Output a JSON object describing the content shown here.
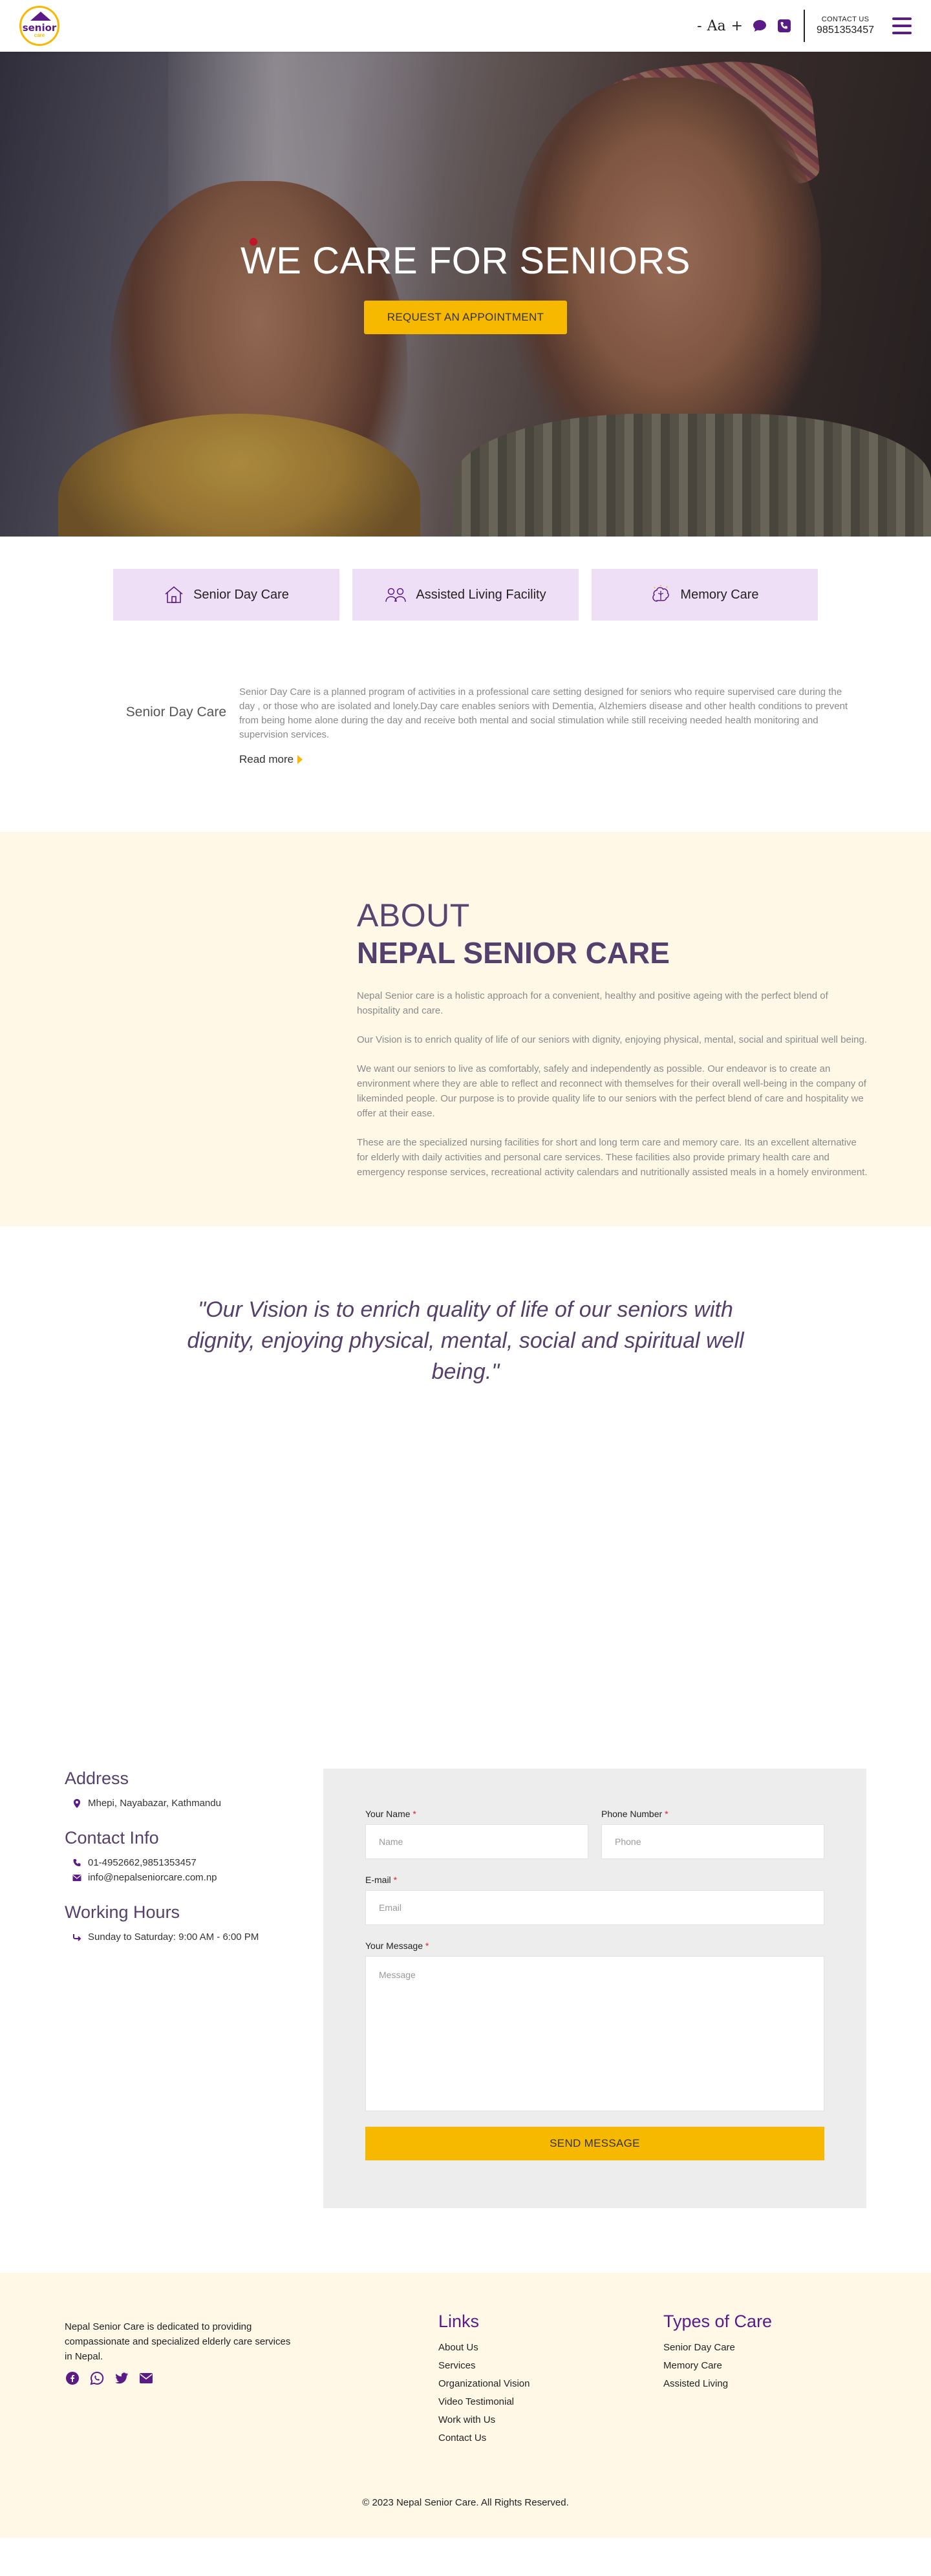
{
  "brand": {
    "logo_text": "senior",
    "logo_subtext": "care",
    "accent_purple": "#5a1b86",
    "accent_yellow": "#f7b800"
  },
  "header": {
    "font_decrease": "-",
    "font_label": "Aa",
    "font_increase": "+",
    "contact_label": "CONTACT US",
    "contact_number": "9851353457"
  },
  "hero": {
    "title": "WE CARE FOR SENIORS",
    "button": "REQUEST AN APPOINTMENT"
  },
  "services": {
    "tabs": [
      {
        "label": "Senior Day Care",
        "icon": "house-icon"
      },
      {
        "label": "Assisted Living Facility",
        "icon": "people-icon"
      },
      {
        "label": "Memory Care",
        "icon": "brain-icon"
      }
    ],
    "detail_title": "Senior Day Care",
    "detail_text": "Senior Day Care is a planned program of activities in a professional care setting designed for seniors who require supervised care during the day , or those who are isolated and lonely.Day care enables seniors with Dementia, Alzhemiers disease and other health conditions to prevent from being home alone during the day and receive both mental and social stimulation while still receiving needed health monitoring and supervision services.",
    "read_more": "Read more"
  },
  "about": {
    "pre_title": "ABOUT",
    "title": "NEPAL SENIOR CARE",
    "paragraphs": [
      "Nepal Senior care is a holistic approach for a convenient, healthy and positive ageing with the perfect blend of hospitality and care.",
      "Our Vision is to enrich quality of life of our seniors with dignity, enjoying physical, mental, social and spiritual well being.",
      "We want our seniors to live as comfortably, safely and independently as possible. Our endeavor is to create an environment where they are able to reflect and reconnect with themselves for their overall well-being in the company of likeminded people. Our purpose is to provide quality life to our seniors with the perfect blend of care and hospitality we offer at their ease.",
      "These are the specialized nursing facilities for short and long term care and memory care. Its an excellent alternative for elderly with daily activities and personal care services. These facilities also provide primary health care and emergency response services, recreational activity calendars and nutritionally assisted meals in a homely environment."
    ]
  },
  "quote": "\"Our Vision is to enrich quality of life of our seniors with dignity, enjoying physical, mental, social and spiritual well being.\"",
  "contact": {
    "address_head": "Address",
    "address": "Mhepi, Nayabazar, Kathmandu",
    "info_head": "Contact Info",
    "phones": "01-4952662,9851353457",
    "email": "info@nepalseniorcare.com.np",
    "hours_head": "Working Hours",
    "hours": "Sunday to Saturday: 9:00 AM - 6:00 PM"
  },
  "form": {
    "name_label": "Your Name",
    "name_placeholder": "Name",
    "phone_label": "Phone Number",
    "phone_placeholder": "Phone",
    "email_label": "E-mail",
    "email_placeholder": "Email",
    "message_label": "Your Message",
    "message_placeholder": "Message",
    "required_mark": "*",
    "submit": "SEND MESSAGE"
  },
  "footer": {
    "about": "Nepal Senior Care is dedicated to providing compassionate and specialized elderly care services in Nepal.",
    "social": [
      "facebook-icon",
      "whatsapp-icon",
      "twitter-icon",
      "mail-icon"
    ],
    "links_head": "Links",
    "links": [
      "About Us",
      "Services",
      "Organizational Vision",
      "Video Testimonial",
      "Work with Us",
      "Contact Us"
    ],
    "types_head": "Types of Care",
    "types": [
      "Senior Day Care",
      "Memory Care",
      "Assisted Living"
    ],
    "copyright": "© 2023 Nepal Senior Care. All Rights Reserved."
  }
}
